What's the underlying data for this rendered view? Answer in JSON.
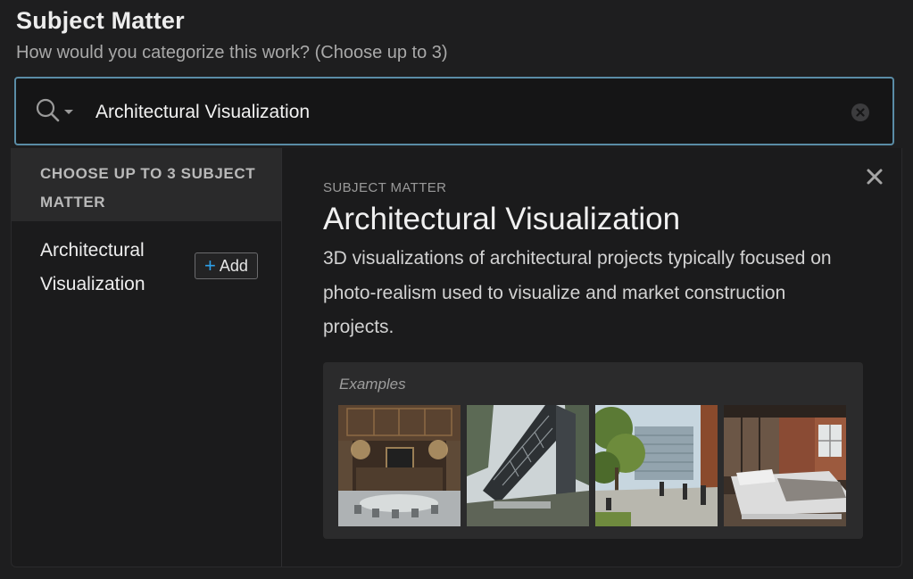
{
  "header": {
    "title": "Subject Matter",
    "subtitle": "How would you categorize this work? (Choose up to 3)"
  },
  "search": {
    "value": "Architectural Visualization",
    "icon": "search-icon",
    "dropdown_icon": "chevron-down-icon",
    "clear_icon": "clear-circle-icon",
    "border_color": "#5a8ca6"
  },
  "options_panel": {
    "header": "CHOOSE UP TO 3 SUBJECT MATTER",
    "items": [
      {
        "label": "Architectural Visualization",
        "add_label": "Add"
      }
    ]
  },
  "detail": {
    "kicker": "SUBJECT MATTER",
    "title": "Architectural Visualization",
    "description": "3D visualizations of architectural projects typically focused on photo-realism used to visualize and market construction projects.",
    "examples_label": "Examples",
    "examples": [
      {
        "name": "example-ornate-interior"
      },
      {
        "name": "example-glass-pavilion-forest"
      },
      {
        "name": "example-urban-courtyard"
      },
      {
        "name": "example-loft-bedroom"
      }
    ]
  },
  "colors": {
    "accent": "#2da0e8",
    "background": "#1e1e1f"
  }
}
